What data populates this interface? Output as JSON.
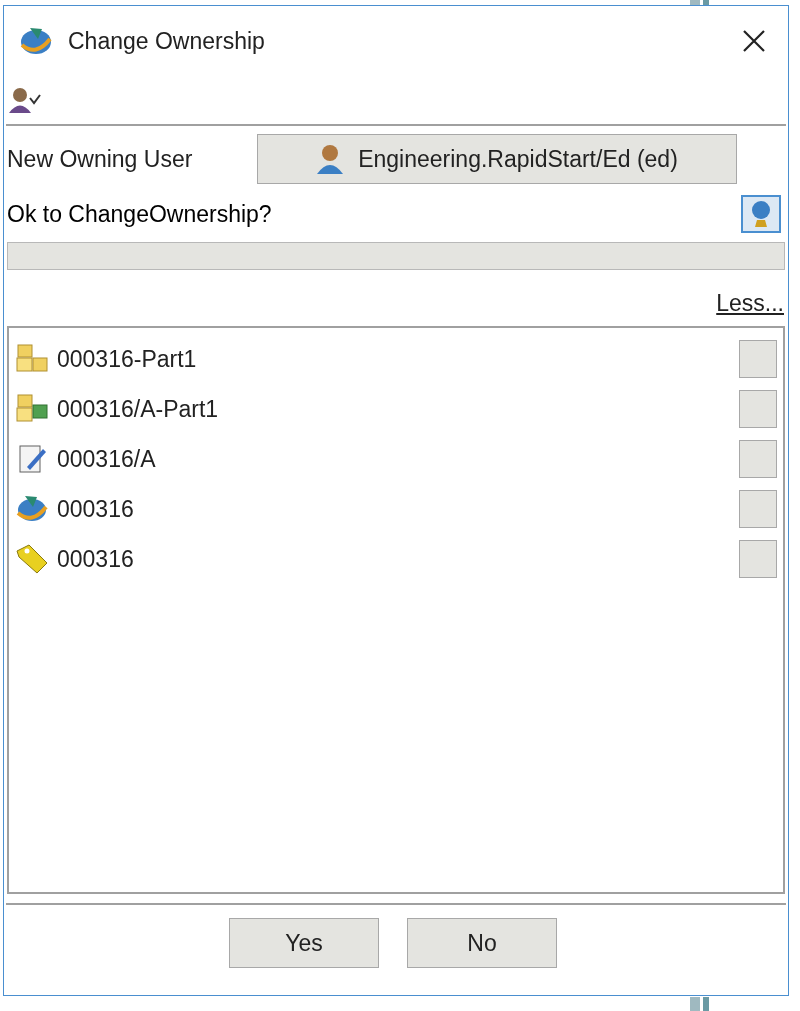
{
  "window": {
    "title": "Change Ownership"
  },
  "owner": {
    "label": "New Owning User",
    "user": "Engineering.RapidStart/Ed (ed)"
  },
  "prompt": "Ok to ChangeOwnership?",
  "progress": {
    "level": 0
  },
  "less_link": "Less...",
  "objects": [
    {
      "kind": "item",
      "name": "000316-Part1",
      "checked": false
    },
    {
      "kind": "item_revision",
      "name": "000316/A-Part1",
      "checked": false
    },
    {
      "kind": "form",
      "name": "000316/A",
      "checked": false
    },
    {
      "kind": "process",
      "name": "000316",
      "checked": false
    },
    {
      "kind": "tag",
      "name": "000316",
      "checked": false
    }
  ],
  "buttons": [
    "Yes",
    "No"
  ]
}
